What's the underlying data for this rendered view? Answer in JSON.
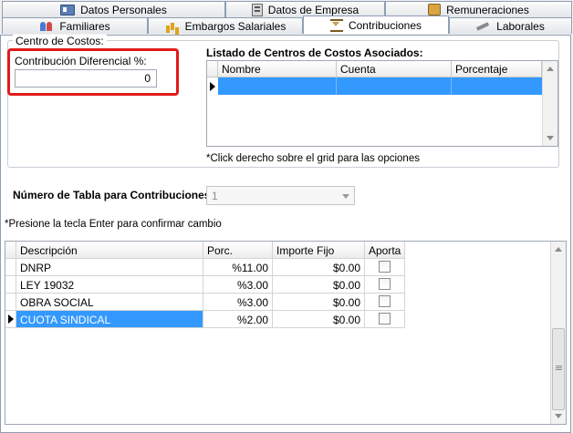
{
  "tabs": {
    "row1": [
      {
        "label": "Datos Personales",
        "icon": "id-card-icon"
      },
      {
        "label": "Datos de Empresa",
        "icon": "building-icon"
      },
      {
        "label": "Remuneraciones",
        "icon": "money-chart-icon"
      }
    ],
    "row2": [
      {
        "label": "Familiares",
        "icon": "people-icon"
      },
      {
        "label": "Embargos Salariales",
        "icon": "bar-chart-icon"
      },
      {
        "label": "Contribuciones",
        "icon": "hourglass-icon",
        "active": true
      },
      {
        "label": "Laborales",
        "icon": "tools-icon"
      }
    ]
  },
  "cost_center": {
    "group_label": "Centro de Costos:",
    "diff_contribution_label": "Contribución Diferencial %:",
    "diff_contribution_value": "0",
    "list_title": "Listado de Centros de Costos Asociados:",
    "columns": [
      "Nombre",
      "Cuenta",
      "Porcentaje"
    ],
    "hint": "*Click derecho sobre el grid para las opciones"
  },
  "table_number": {
    "label": "Número de Tabla para Contribuciones:",
    "value": "1"
  },
  "enter_hint": "*Presione la tecla Enter para confirmar cambio",
  "contributions": {
    "columns": [
      "Descripción",
      "Porc.",
      "Importe Fijo",
      "Aporta"
    ],
    "rows": [
      {
        "descripcion": "DNRP",
        "porc": "%11.00",
        "importe": "$0.00",
        "aporta": false
      },
      {
        "descripcion": "LEY 19032",
        "porc": "%3.00",
        "importe": "$0.00",
        "aporta": false
      },
      {
        "descripcion": "OBRA SOCIAL",
        "porc": "%3.00",
        "importe": "$0.00",
        "aporta": false
      },
      {
        "descripcion": "CUOTA SINDICAL",
        "porc": "%2.00",
        "importe": "$0.00",
        "aporta": false,
        "selected": true
      }
    ]
  },
  "colors": {
    "highlight": "#e11b1b",
    "selection": "#3399ff"
  }
}
